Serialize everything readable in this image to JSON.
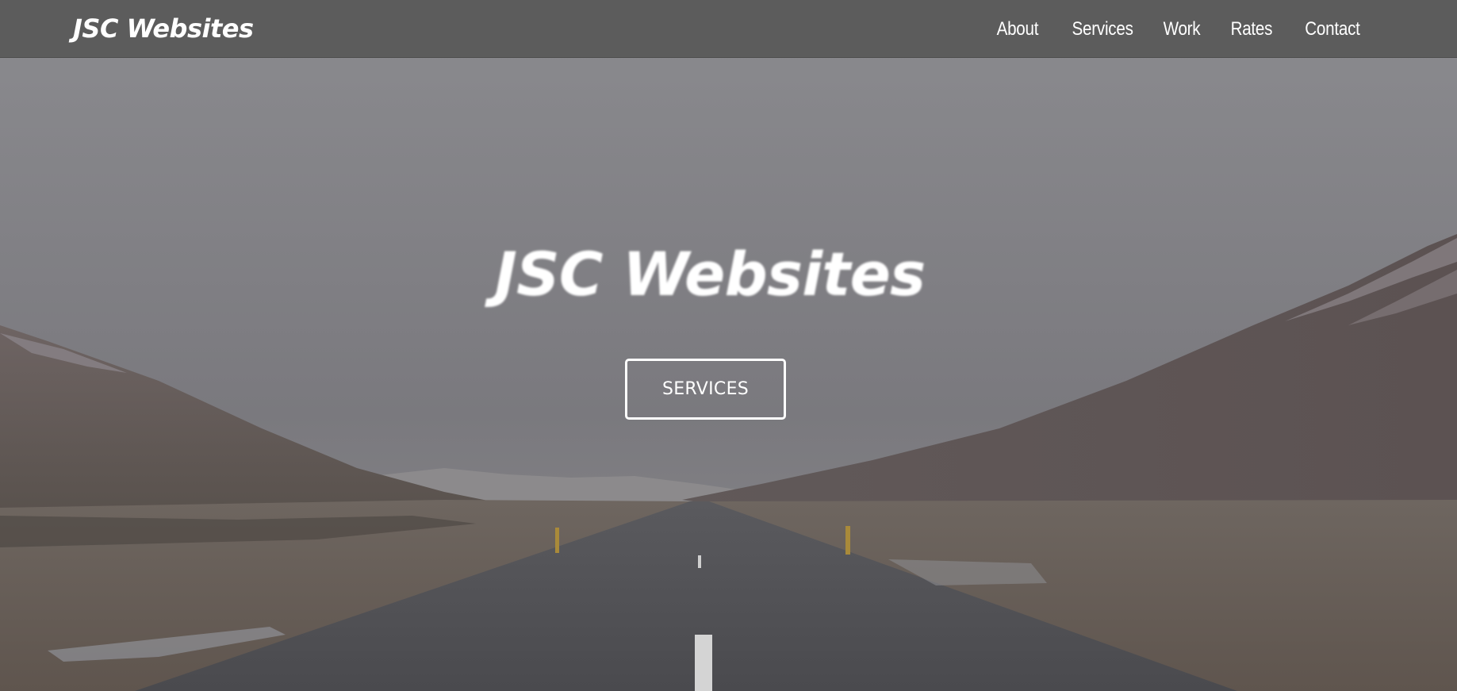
{
  "header": {
    "brand": "JSC Websites",
    "nav": [
      {
        "label": "About"
      },
      {
        "label": "Services"
      },
      {
        "label": "Work"
      },
      {
        "label": "Rates"
      },
      {
        "label": "Contact"
      }
    ]
  },
  "hero": {
    "title": "JSC Websites",
    "button_label": "SERVICES",
    "background_image": "road-through-mountain-valley"
  },
  "colors": {
    "navbar_bg": "#5a5a5a",
    "text": "#ffffff",
    "overlay": "#7a7a7e"
  }
}
